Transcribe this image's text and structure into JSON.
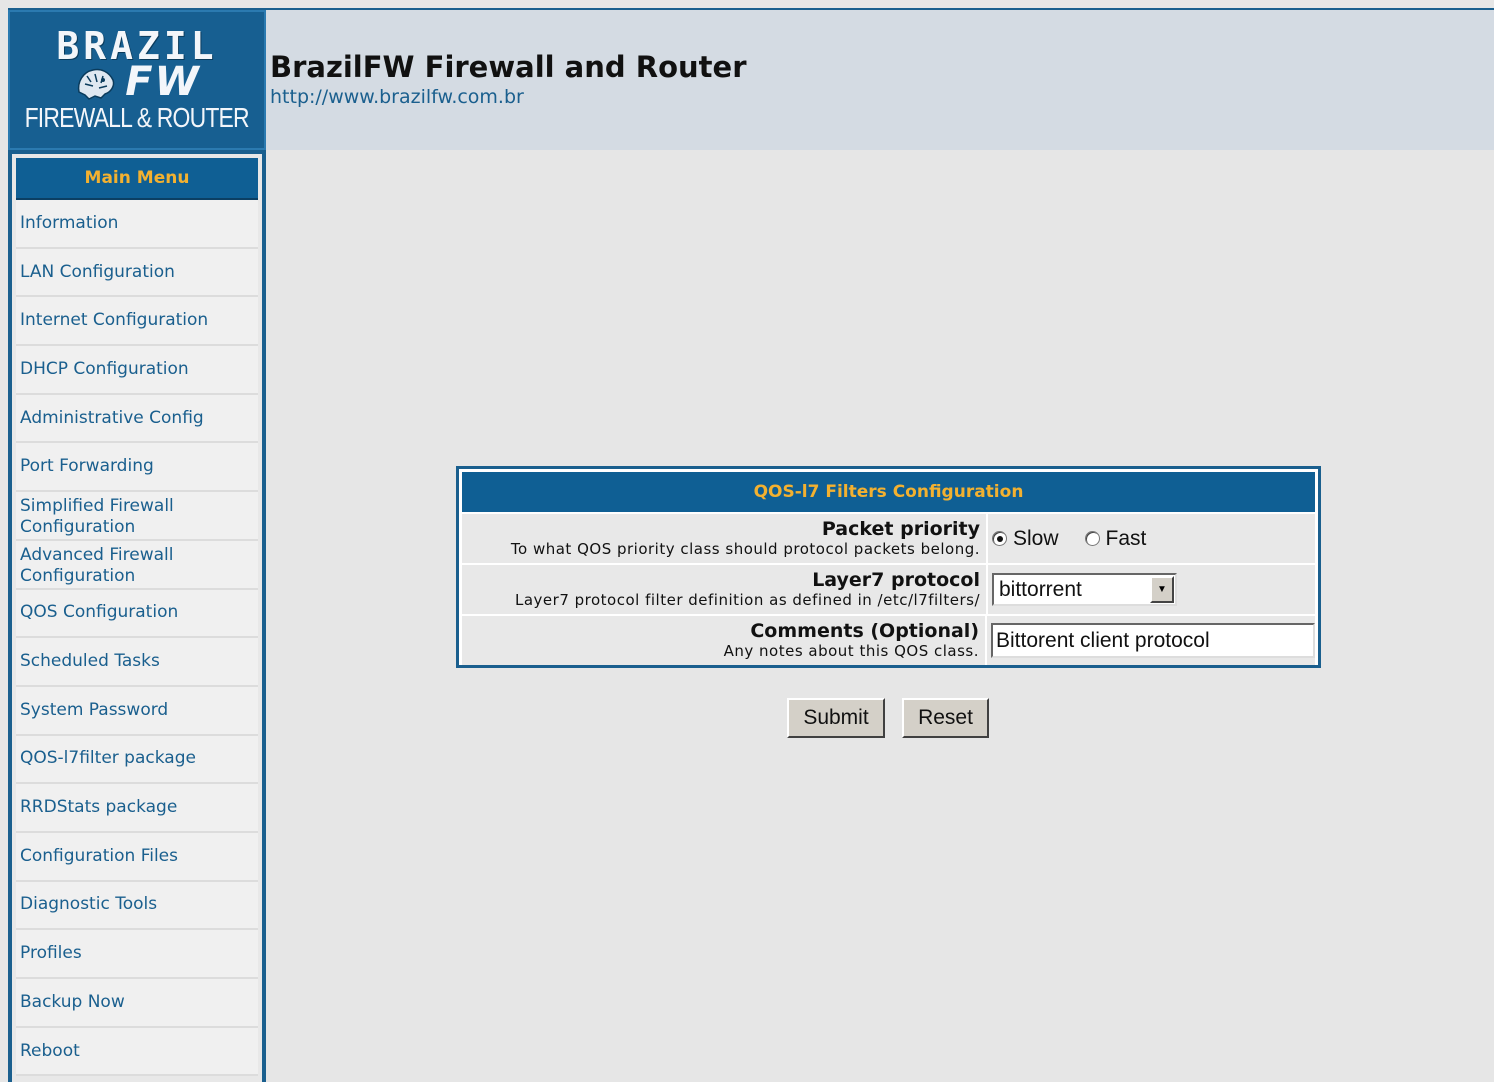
{
  "logo": {
    "line1": "BRAZIL",
    "line2": "FW",
    "line3": "FIREWALL & ROUTER"
  },
  "header": {
    "title": "BrazilFW Firewall and Router",
    "url": "http://www.brazilfw.com.br"
  },
  "sidebar": {
    "title": "Main Menu",
    "items": [
      "Information",
      "LAN Configuration",
      "Internet Configuration",
      "DHCP Configuration",
      "Administrative Config",
      "Port Forwarding",
      "Simplified Firewall Configuration",
      "Advanced Firewall Configuration",
      "QOS Configuration",
      "Scheduled Tasks",
      "System Password",
      "QOS-l7filter package",
      "RRDStats package",
      "Configuration Files",
      "Diagnostic Tools",
      "Profiles",
      "Backup Now",
      "Reboot"
    ]
  },
  "panel": {
    "title": "QOS-l7 Filters Configuration",
    "priority": {
      "label": "Packet priority",
      "description": "To what QOS priority class should protocol packets belong.",
      "options": [
        "Slow",
        "Fast"
      ],
      "selected": "Slow"
    },
    "protocol": {
      "label": "Layer7 protocol",
      "description": "Layer7 protocol filter definition as defined in /etc/l7filters/",
      "value": "bittorrent"
    },
    "comments": {
      "label": "Comments (Optional)",
      "description": "Any notes about this QOS class.",
      "value": "Bittorent client protocol"
    }
  },
  "buttons": {
    "submit": "Submit",
    "reset": "Reset"
  },
  "colors": {
    "brand_blue": "#0f5f94",
    "menu_title_text": "#f3b130",
    "link": "#1a5f8e"
  }
}
